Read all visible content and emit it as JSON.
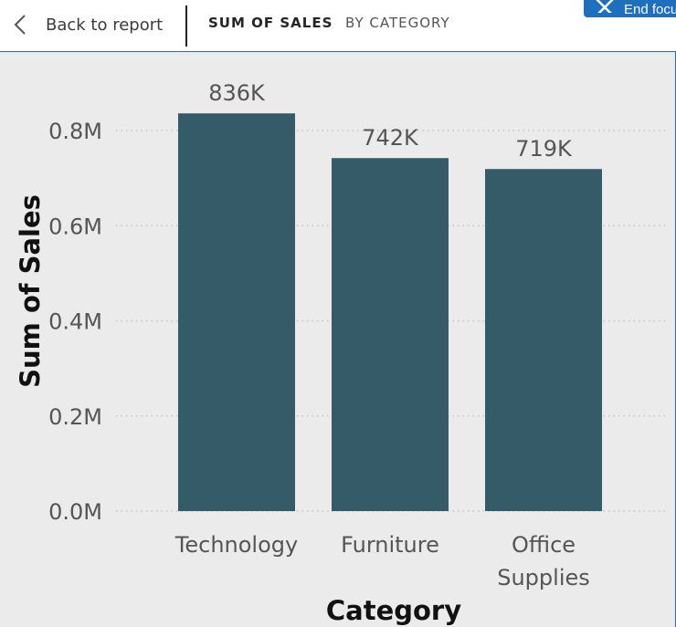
{
  "header": {
    "back_label": "Back to report",
    "crumbs": [
      "SUM OF SALES",
      "BY CATEGORY"
    ],
    "focus_label": "End focus mode"
  },
  "icons": {
    "back": "chevron-left-icon",
    "close": "close-icon"
  },
  "colors": {
    "bar": "#345b67",
    "focus_button": "#1f6fbf",
    "chart_background": "#ebebeb"
  },
  "chart_data": {
    "type": "bar",
    "categories": [
      "Technology",
      "Furniture",
      "Office Supplies"
    ],
    "values": [
      836000,
      742000,
      719000
    ],
    "data_labels": [
      "836K",
      "742K",
      "719K"
    ],
    "xlabel": "Category",
    "ylabel": "Sum of Sales",
    "ylim": [
      0,
      800000
    ],
    "yticks": [
      0,
      200000,
      400000,
      600000,
      800000
    ],
    "ytick_labels": [
      "0.0M",
      "0.2M",
      "0.4M",
      "0.6M",
      "0.8M"
    ],
    "grid": true
  }
}
